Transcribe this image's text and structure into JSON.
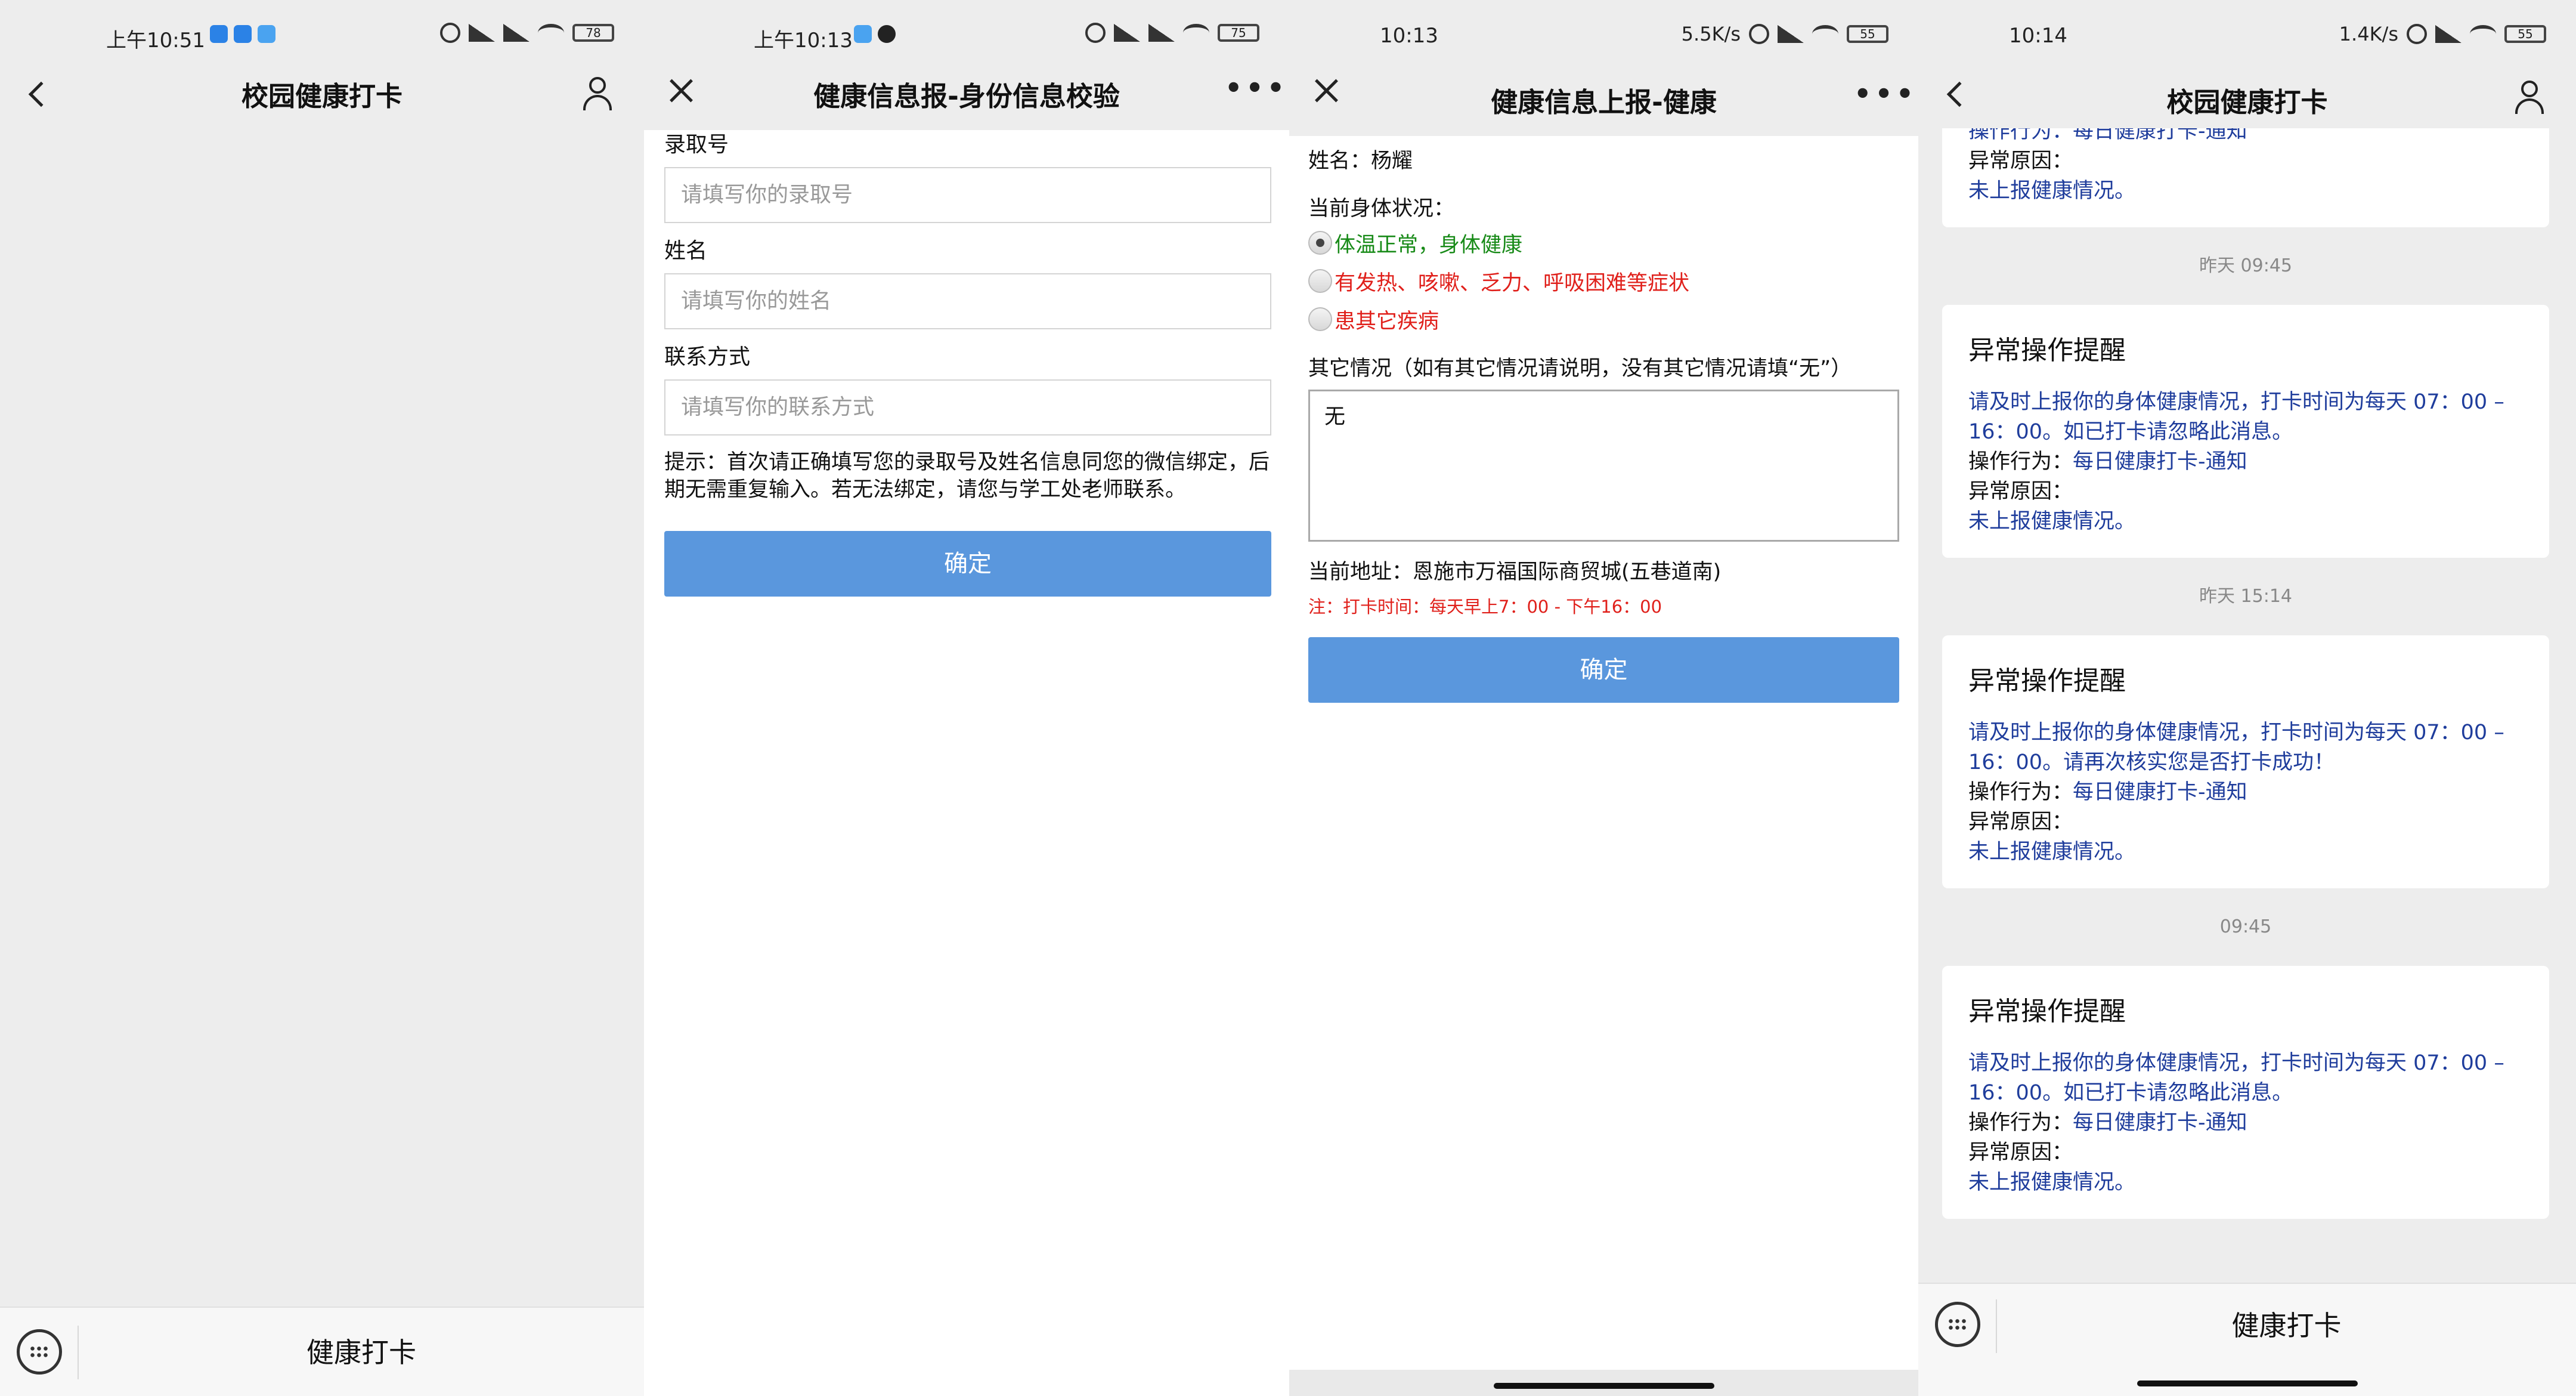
{
  "screens": [
    {
      "status_bar": {
        "time": "上午10:51",
        "battery": "78"
      },
      "nav": {
        "title": "校园健康打卡"
      },
      "bottom_menu": {
        "label": "健康打卡"
      }
    },
    {
      "status_bar": {
        "time": "上午10:13",
        "battery": "75"
      },
      "nav": {
        "title": "健康信息报-身份信息校验",
        "more": "•••"
      },
      "form": {
        "fields": [
          {
            "label": "录取号",
            "placeholder": "请填写你的录取号"
          },
          {
            "label": "姓名",
            "placeholder": "请填写你的姓名"
          },
          {
            "label": "联系方式",
            "placeholder": "请填写你的联系方式"
          }
        ],
        "hint": "提示：首次请正确填写您的录取号及姓名信息同您的微信绑定，后期无需重复输入。若无法绑定，请您与学工处老师联系。",
        "submit": "确定"
      }
    },
    {
      "status_bar": {
        "time": "10:13",
        "speed": "5.5K/s",
        "battery": "55"
      },
      "nav": {
        "title": "健康信息上报-健康",
        "more": "•••"
      },
      "form": {
        "name_line": "姓名：杨耀",
        "condition_label": "当前身体状况：",
        "options": [
          {
            "label": "体温正常，身体健康",
            "checked": true,
            "color": "#178a17"
          },
          {
            "label": "有发热、咳嗽、乏力、呼吸困难等症状",
            "checked": false,
            "color": "#e0201b"
          },
          {
            "label": "患其它疾病",
            "checked": false,
            "color": "#e0201b"
          }
        ],
        "other_label": "其它情况（如有其它情况请说明，没有其它情况请填“无”）",
        "other_value": "无",
        "address": "当前地址：恩施市万福国际商贸城(五巷道南)",
        "note": "注：打卡时间：每天早上7：00 - 下午16：00",
        "submit": "确定"
      }
    },
    {
      "status_bar": {
        "time": "10:14",
        "speed": "1.4K/s",
        "battery": "55"
      },
      "nav": {
        "title": "校园健康打卡"
      },
      "top_card": {
        "action_line": "操作行为：每日健康打卡-通知",
        "reason_label": "异常原因：",
        "reason_value": "未上报健康情况。"
      },
      "messages": [
        {
          "timestamp": "昨天 09:45",
          "title": "异常操作提醒",
          "body": "请及时上报你的身体健康情况，打卡时间为每天 07：00 – 16：00。如已打卡请忽略此消息。",
          "action_label": "操作行为：",
          "action_value": "每日健康打卡-通知",
          "reason_label": "异常原因：",
          "reason_value": "未上报健康情况。"
        },
        {
          "timestamp": "昨天 15:14",
          "title": "异常操作提醒",
          "body": "请及时上报你的身体健康情况，打卡时间为每天 07：00 – 16：00。请再次核实您是否打卡成功！",
          "action_label": "操作行为：",
          "action_value": "每日健康打卡-通知",
          "reason_label": "异常原因：",
          "reason_value": "未上报健康情况。"
        },
        {
          "timestamp": "09:45",
          "title": "异常操作提醒",
          "body": "请及时上报你的身体健康情况，打卡时间为每天 07：00 – 16：00。如已打卡请忽略此消息。",
          "action_label": "操作行为：",
          "action_value": "每日健康打卡-通知",
          "reason_label": "异常原因：",
          "reason_value": "未上报健康情况。"
        }
      ],
      "bottom_menu": {
        "label": "健康打卡"
      }
    }
  ]
}
